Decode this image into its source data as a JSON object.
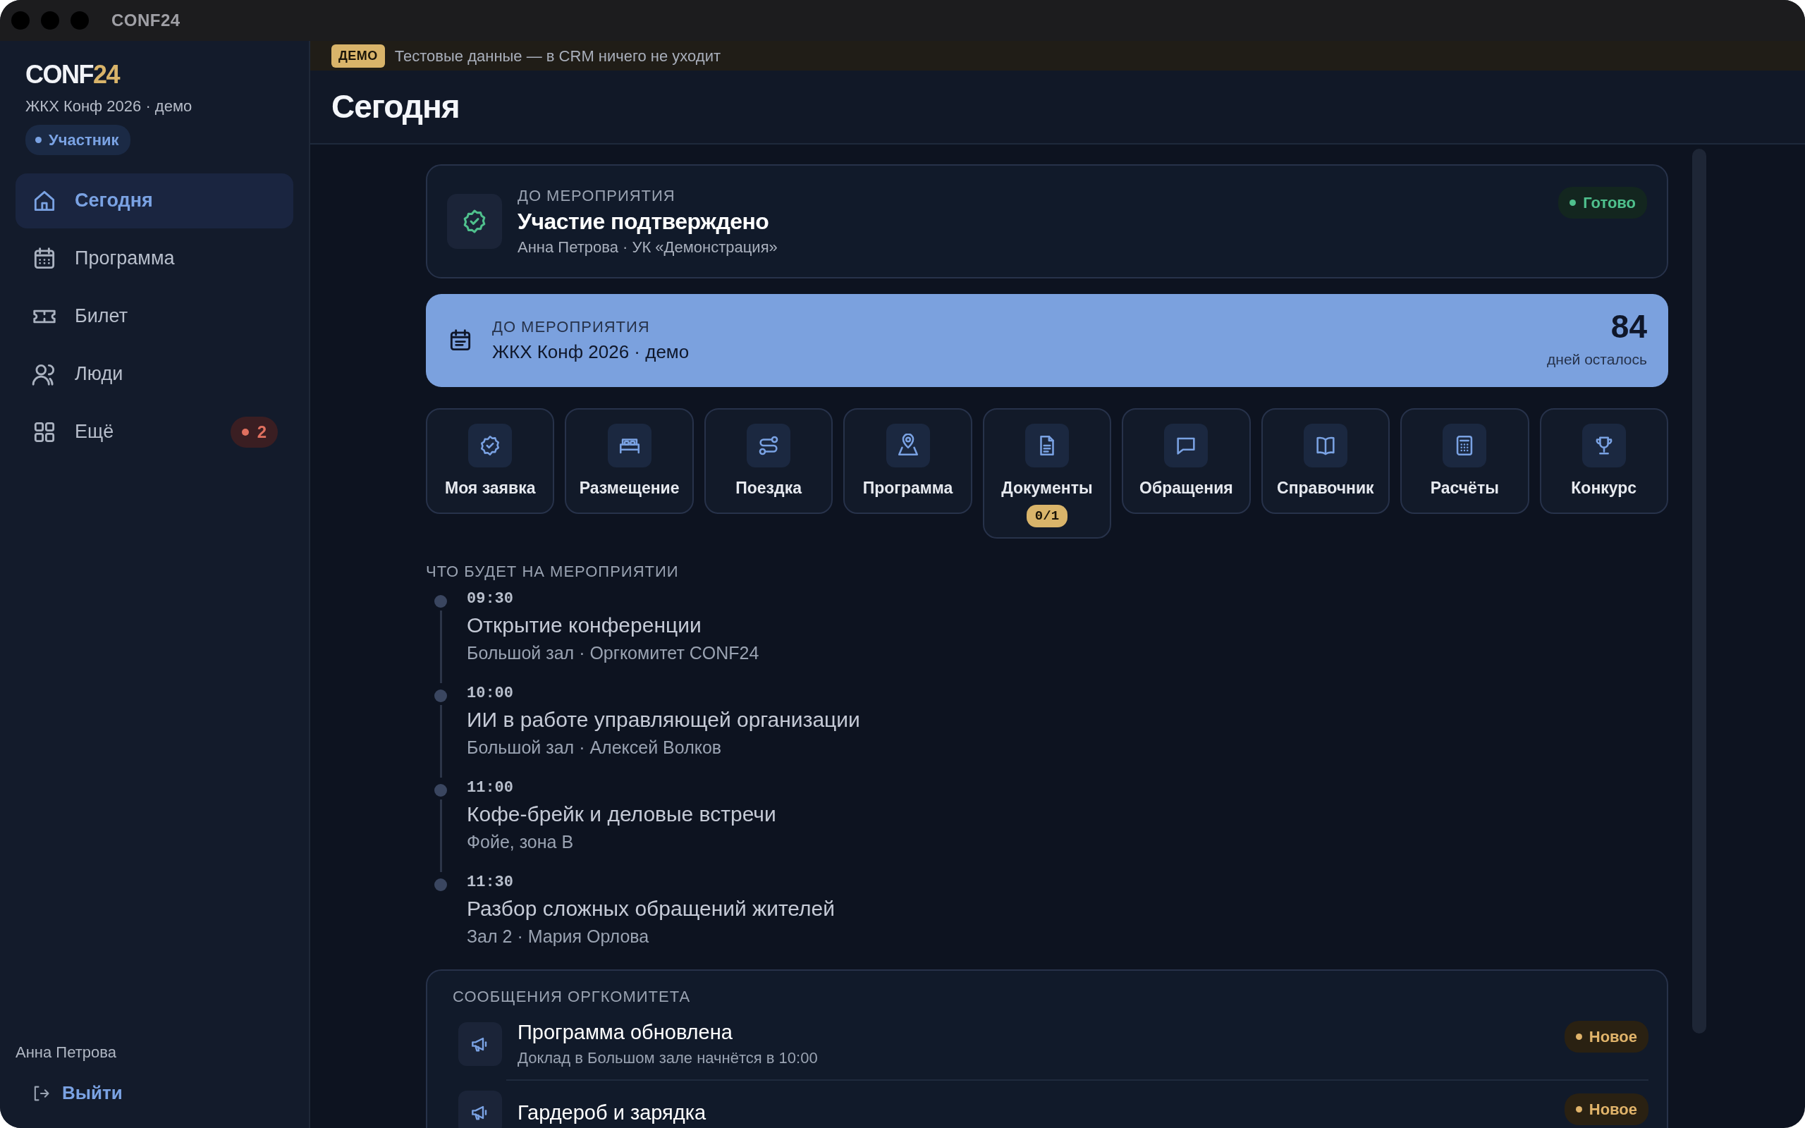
{
  "window": {
    "title": "CONF24"
  },
  "sidebar": {
    "logo": {
      "main": "CONF",
      "accent": "24"
    },
    "event": "ЖКХ Конф 2026 · демо",
    "role": "Участник",
    "items": [
      {
        "label": "Сегодня",
        "selected": true
      },
      {
        "label": "Программа",
        "selected": false
      },
      {
        "label": "Билет",
        "selected": false
      },
      {
        "label": "Люди",
        "selected": false
      },
      {
        "label": "Ещё",
        "selected": false,
        "badge": "2"
      }
    ],
    "user": "Анна Петрова",
    "logout": "Выйти"
  },
  "demo_banner": {
    "badge": "ДЕМО",
    "text": "Тестовые данные — в CRM ничего не уходит"
  },
  "page_title": "Сегодня",
  "status_card": {
    "label": "ДО МЕРОПРИЯТИЯ",
    "title": "Участие подтверждено",
    "subtitle": "Анна Петрова · УК «Демонстрация»",
    "status": "Готово"
  },
  "countdown": {
    "label": "ДО МЕРОПРИЯТИЯ",
    "event": "ЖКХ Конф 2026 · демо",
    "days": "84",
    "days_label": "дней осталось"
  },
  "tiles": [
    {
      "label": "Моя заявка"
    },
    {
      "label": "Размещение"
    },
    {
      "label": "Поездка"
    },
    {
      "label": "Программа"
    },
    {
      "label": "Документы",
      "badge": "0/1"
    },
    {
      "label": "Обращения"
    },
    {
      "label": "Справочник"
    },
    {
      "label": "Расчёты"
    },
    {
      "label": "Конкурс"
    }
  ],
  "schedule": {
    "heading": "ЧТО БУДЕТ НА МЕРОПРИЯТИИ",
    "items": [
      {
        "time": "09:30",
        "title": "Открытие конференции",
        "details": "Большой зал · Оргкомитет CONF24"
      },
      {
        "time": "10:00",
        "title": "ИИ в работе управляющей организации",
        "details": "Большой зал · Алексей Волков"
      },
      {
        "time": "11:00",
        "title": "Кофе-брейк и деловые встречи",
        "details": "Фойе, зона B"
      },
      {
        "time": "11:30",
        "title": "Разбор сложных обращений жителей",
        "details": "Зал 2 · Мария Орлова"
      }
    ]
  },
  "messages": {
    "heading": "СООБЩЕНИЯ ОРГКОМИТЕТА",
    "items": [
      {
        "title": "Программа обновлена",
        "text": "Доклад в Большом зале начнётся в 10:00",
        "status": "Новое"
      },
      {
        "title": "Гардероб и зарядка",
        "status": "Новое"
      }
    ]
  }
}
